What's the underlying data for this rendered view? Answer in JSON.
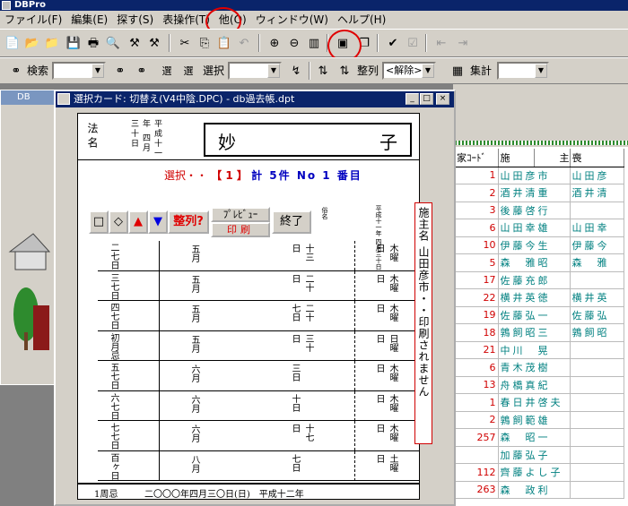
{
  "window": {
    "title": "DBPro"
  },
  "menu": [
    {
      "label": "ファイル(F)"
    },
    {
      "label": "編集(E)"
    },
    {
      "label": "探す(S)"
    },
    {
      "label": "表操作(T)"
    },
    {
      "label": "他(O)"
    },
    {
      "label": "ウィンドウ(W)"
    },
    {
      "label": "ヘルプ(H)"
    }
  ],
  "toolbar2": {
    "search_label": "検索",
    "select_label": "選択",
    "sort_label": "整列",
    "sort_value": "<解除>",
    "total_label": "集計",
    "select_tag": "選",
    "select_tag2": "選"
  },
  "bg_window_left": {
    "title": "DB"
  },
  "card_window": {
    "title": "選択カード: 切替え(V4中陰.DPC) - db過去帳.dpt",
    "minimize": "_",
    "maximize": "□",
    "close": "×"
  },
  "card": {
    "header_label": "法名",
    "header_date": "平成十一年 四月三十日",
    "name_left": "妙",
    "name_right": "子",
    "select_label": "選択・・",
    "select_index": "【 1 】",
    "select_count": "計 5件 No 1 番目",
    "buttons": {
      "square": "□",
      "diamond": "◇",
      "up": "▲",
      "down": "▼",
      "sort": "整列?",
      "preview": "ﾌﾟﾚﾋﾞｭｰ",
      "print": "印刷",
      "close": "終了"
    },
    "gomei": "俗名",
    "date_small": "平成十一年 四月三十日",
    "rows": [
      {
        "c1": "二七日",
        "c2": "五月",
        "c3": "十三日",
        "c4": "木曜日"
      },
      {
        "c1": "三七日",
        "c2": "五月",
        "c3": "二十日",
        "c4": "木曜日"
      },
      {
        "c1": "四七日",
        "c2": "五月",
        "c3": "二十七日",
        "c4": "木曜日"
      },
      {
        "c1": "初月忌",
        "c2": "五月",
        "c3": "三十日",
        "c4": "日曜日"
      },
      {
        "c1": "五七日",
        "c2": "六月",
        "c3": "三日",
        "c4": "木曜日"
      },
      {
        "c1": "六七日",
        "c2": "六月",
        "c3": "十日",
        "c4": "木曜日"
      },
      {
        "c1": "七七日",
        "c2": "六月",
        "c3": "十七日",
        "c4": "木曜日"
      },
      {
        "c1": "百ヶ日",
        "c2": "八月",
        "c3": "七日",
        "c4": "土曜日"
      }
    ],
    "footer_label": "1周忌",
    "footer_text": "二〇〇〇年四月三〇日(日)　平成十二年"
  },
  "info_strip": "施主名 山田彦市・・印刷されません",
  "sheet": {
    "headers": [
      "家ｺｰﾄﾞ",
      "施",
      "主",
      "喪"
    ],
    "rows": [
      {
        "num": "1",
        "name": "山田彦市",
        "sub": "山田彦"
      },
      {
        "num": "2",
        "name": "酒井清重",
        "sub": "酒井清"
      },
      {
        "num": "3",
        "name": "後藤啓行",
        "sub": ""
      },
      {
        "num": "6",
        "name": "山田幸雄",
        "sub": "山田幸"
      },
      {
        "num": "10",
        "name": "伊藤今生",
        "sub": "伊藤今"
      },
      {
        "num": "5",
        "name": "森　雅昭",
        "sub": "森　雅"
      },
      {
        "num": "17",
        "name": "佐藤充郎",
        "sub": ""
      },
      {
        "num": "22",
        "name": "横井英徳",
        "sub": "横井英"
      },
      {
        "num": "19",
        "name": "佐藤弘一",
        "sub": "佐藤弘"
      },
      {
        "num": "18",
        "name": "鶉飼昭三",
        "sub": "鶉飼昭"
      },
      {
        "num": "21",
        "name": "中川　晃",
        "sub": ""
      },
      {
        "num": "6",
        "name": "青木茂樹",
        "sub": ""
      },
      {
        "num": "13",
        "name": "舟橋真紀",
        "sub": ""
      },
      {
        "num": "1",
        "name": "春日井啓夫",
        "sub": ""
      },
      {
        "num": "2",
        "name": "鶉飼範雄",
        "sub": ""
      },
      {
        "num": "257",
        "name": "森　昭一",
        "sub": ""
      },
      {
        "num": "",
        "name": "加藤弘子",
        "sub": ""
      },
      {
        "num": "112",
        "name": "齊藤よし子",
        "sub": ""
      },
      {
        "num": "263",
        "name": "森　政利",
        "sub": ""
      }
    ]
  },
  "colors": {
    "titlebar": "#0a246a",
    "highlight_circle": "#e00000",
    "sheet_name": "#008080",
    "sheet_num": "#d00000"
  }
}
